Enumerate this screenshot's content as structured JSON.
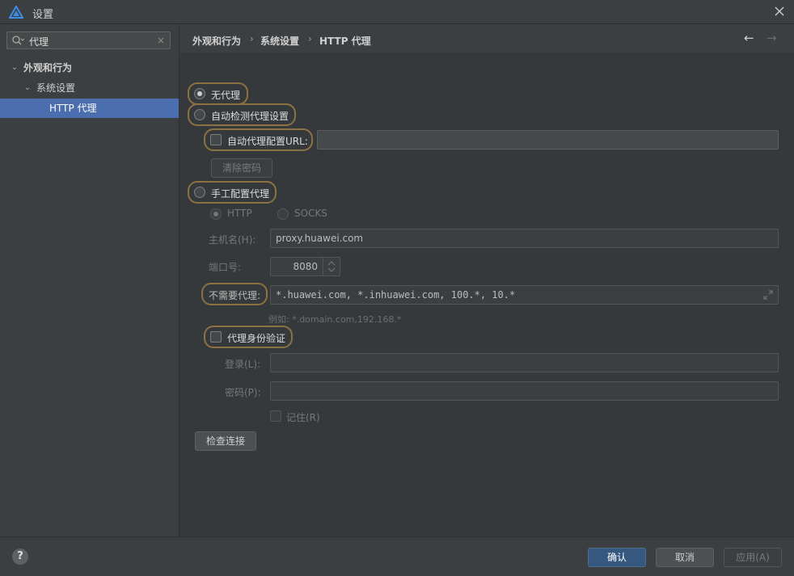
{
  "window": {
    "title": "设置",
    "app_icon": "harmony-deveco-logo-icon",
    "close_icon": "close-icon"
  },
  "sidebar": {
    "search": {
      "value": "代理",
      "search_icon": "search-icon",
      "clear_icon": "clear-icon",
      "clear_glyph": "×"
    },
    "tree": [
      {
        "label": "外观和行为",
        "expanded": true,
        "level": 0
      },
      {
        "label": "系统设置",
        "expanded": true,
        "level": 1
      },
      {
        "label": "HTTP 代理",
        "selected": true,
        "level": 2
      }
    ]
  },
  "breadcrumb": {
    "items": [
      "外观和行为",
      "系统设置",
      "HTTP 代理"
    ],
    "separator": "›",
    "back_glyph": "←",
    "forward_glyph": "→"
  },
  "proxy": {
    "no_proxy": "无代理",
    "auto_detect": "自动检测代理设置",
    "auto_url_label": "自动代理配置URL:",
    "auto_url_value": "",
    "clear_password": "清除密码",
    "manual": "手工配置代理",
    "http": "HTTP",
    "socks": "SOCKS",
    "host_label": "主机名(H):",
    "host_value": "proxy.huawei.com",
    "port_label": "端口号:",
    "port_value": "8080",
    "no_proxy_for_label": "不需要代理:",
    "no_proxy_for_value": "*.huawei.com, *.inhuawei.com, 100.*, 10.*",
    "example": "例如: *.domain.com,192.168.*",
    "auth": "代理身份验证",
    "login_label": "登录(L):",
    "login_value": "",
    "password_label": "密码(P):",
    "password_value": "",
    "remember": "记住(R)",
    "check_connection": "检查连接",
    "selected_mode": "no_proxy"
  },
  "footer": {
    "help": "?",
    "ok": "确认",
    "cancel": "取消",
    "apply": "应用(A)"
  },
  "colors": {
    "background": "#3c3f41",
    "panel": "#36393b",
    "selection": "#4b6eaf",
    "highlight_ring": "#8c7242",
    "primary_button": "#365880"
  }
}
